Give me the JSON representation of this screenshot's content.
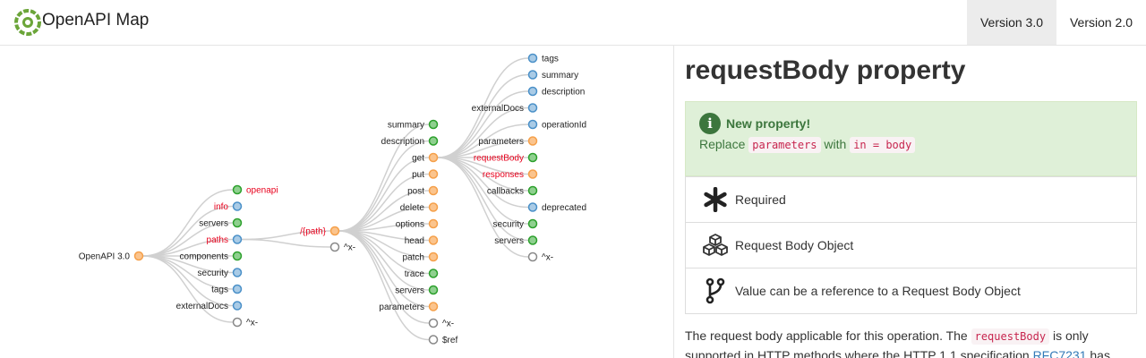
{
  "app": {
    "title": "OpenAPI Map"
  },
  "nav": {
    "v30": "Version 3.0",
    "v20": "Version 2.0",
    "active": "v30"
  },
  "map": {
    "root": "OpenAPI 3.0",
    "level1": [
      "openapi",
      "info",
      "servers",
      "paths",
      "components",
      "security",
      "tags",
      "externalDocs",
      "^x-"
    ],
    "level2": [
      "/{path}",
      "^x-"
    ],
    "level3": [
      "summary",
      "description",
      "get",
      "put",
      "post",
      "delete",
      "options",
      "head",
      "patch",
      "trace",
      "servers",
      "parameters",
      "^x-",
      "$ref"
    ],
    "level4": [
      "tags",
      "summary",
      "description",
      "externalDocs",
      "operationId",
      "parameters",
      "requestBody",
      "responses",
      "callbacks",
      "deprecated",
      "security",
      "servers",
      "^x-"
    ]
  },
  "panel": {
    "title": "requestBody property",
    "alert": {
      "title": "New property!",
      "line_prefix": "Replace",
      "code1": "parameters",
      "line_mid": "with",
      "code2": "in = body"
    },
    "items": [
      {
        "icon": "asterisk-icon",
        "label": "Required"
      },
      {
        "icon": "cubes-icon",
        "label": "Request Body Object"
      },
      {
        "icon": "code-fork-icon",
        "label": "Value can be a reference to a Request Body Object"
      }
    ],
    "desc": {
      "part1": "The request body applicable for this operation. The",
      "code": "requestBody",
      "part2": "is only supported in HTTP methods where the HTTP 1.1 specification",
      "link": "RFC7231",
      "part3": "has"
    }
  },
  "colors": {
    "edge": "#d0d0d0",
    "green": "#2ca02c",
    "blue": "#4a90c8",
    "orange": "#f5a04a",
    "grey": "#888888",
    "highlight_text": "#e8001c"
  }
}
